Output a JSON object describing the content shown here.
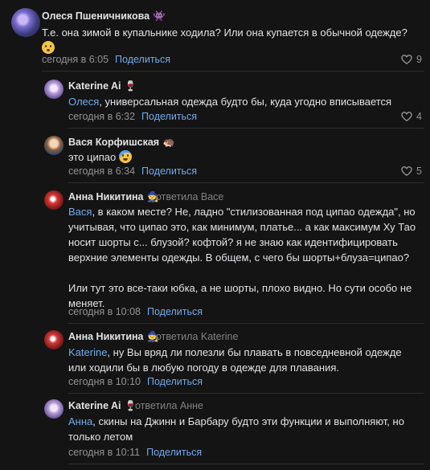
{
  "comments": [
    {
      "author": "Олеся Пшеничникова",
      "author_emoji": "👾",
      "text": "Т.е. она зимой в купальнике ходила? Или она купается в обычной одежде?",
      "time": "сегодня в 6:05",
      "share": "Поделиться",
      "likes": "9"
    },
    {
      "author": "Katerine Ai",
      "author_emoji": "🍷",
      "mention": "Олеся",
      "text": ", универсальная одежда будто бы, куда угодно вписывается",
      "time": "сегодня в 6:32",
      "share": "Поделиться",
      "likes": "4"
    },
    {
      "author": "Вася Корфишская",
      "author_emoji": "🦔",
      "text": "это ципао",
      "time": "сегодня в 6:34",
      "share": "Поделиться",
      "likes": "5"
    },
    {
      "author": "Анна Никитина",
      "author_emoji": "🧙",
      "replied": "ответила Васе",
      "mention": "Вася",
      "text_line1": ", в каком месте? Не, ладно \"стилизованная под ципао одежда\", но",
      "text_line2": "учитывая, что ципао это, как минимум, платье... а как максимум Ху Тао",
      "text_line3": "носит шорты с... блузой? кофтой? я не знаю как идентифицировать",
      "text_line4": "верхние элементы одежды. В общем, с чего бы шорты+блуза=ципао?",
      "text_line5": "Или тут это все-таки юбка, а не шорты, плохо видно. Но сути особо не",
      "text_line6": "меняет.",
      "time": "сегодня в 10:08",
      "share": "Поделиться"
    },
    {
      "author": "Анна Никитина",
      "author_emoji": "🧙",
      "replied": "ответила Katerine",
      "mention": "Katerine",
      "text_line1": ", ну Вы вряд ли полезли бы плавать в повседневной одежде",
      "text_line2": "или ходили бы в любую погоду в одежде для плавания.",
      "time": "сегодня в 10:10",
      "share": "Поделиться"
    },
    {
      "author": "Katerine Ai",
      "author_emoji": "🍷",
      "replied": "ответила Анне",
      "mention": "Анна",
      "text_line1": ", скины на Джинн и Барбару будто эти функции и выполняют, но",
      "text_line2": "только летом",
      "time": "сегодня в 10:11",
      "share": "Поделиться"
    }
  ],
  "icons": {
    "like": "heart-icon",
    "replied": "reply-arrow-icon",
    "emoji_confused": "flushed-face-icon",
    "emoji_cry": "crying-face-icon"
  },
  "colors": {
    "background": "#141414",
    "text": "#e1e3e6",
    "link": "#71aaeb",
    "muted": "#939393",
    "divider": "#2c2d2e"
  }
}
